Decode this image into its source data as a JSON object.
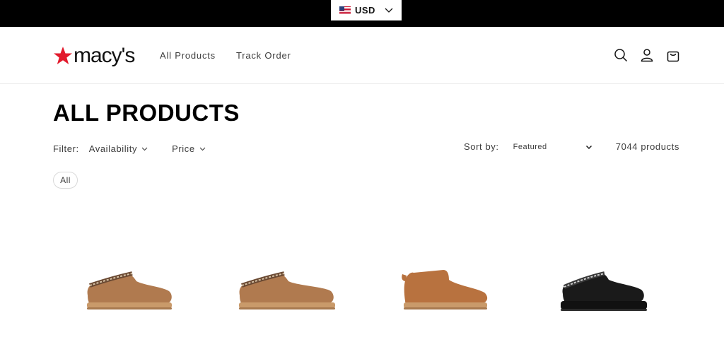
{
  "topbar": {
    "currency": "USD"
  },
  "header": {
    "logo_text": "macy's",
    "nav": [
      "All Products",
      "Track Order"
    ]
  },
  "page": {
    "title": "ALL PRODUCTS",
    "filter_label": "Filter:",
    "filters": [
      "Availability",
      "Price"
    ],
    "sort_label": "Sort by:",
    "sort_value": "Featured",
    "product_count": "7044 products",
    "active_chip": "All"
  },
  "colors": {
    "topbar_bg": "#000000",
    "logo_star": "#e21a2c",
    "chestnut": "#b07a4f",
    "black_shoe": "#1a1a1a"
  },
  "icons": [
    "us-flag-icon",
    "chevron-down-icon",
    "search-icon",
    "account-icon",
    "cart-icon"
  ]
}
